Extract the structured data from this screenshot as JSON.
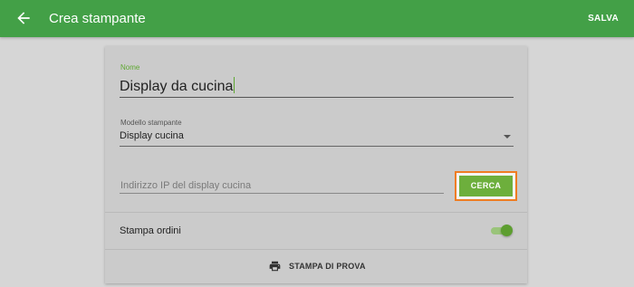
{
  "app_bar": {
    "back_icon": "arrow-left-icon",
    "title": "Crea stampante",
    "save_label": "SALVA",
    "color": "#43a047"
  },
  "form": {
    "name": {
      "label": "Nome",
      "value": "Display da cucina"
    },
    "printer_model": {
      "label": "Modello stampante",
      "value": "Display cucina",
      "dropdown_icon": "dropdown-arrow-icon"
    },
    "ip_address": {
      "placeholder": "Indirizzo IP del display cucina",
      "value": ""
    },
    "search_label": "CERCA",
    "print_orders": {
      "label": "Stampa ordini",
      "enabled": true
    },
    "test_print": {
      "icon": "printer-icon",
      "label": "STAMPA DI PROVA"
    }
  },
  "colors": {
    "accent": "#6daf3c",
    "highlight_border": "#ef7d22",
    "background": "#d6d6d6",
    "card": "#cbcbcb"
  }
}
